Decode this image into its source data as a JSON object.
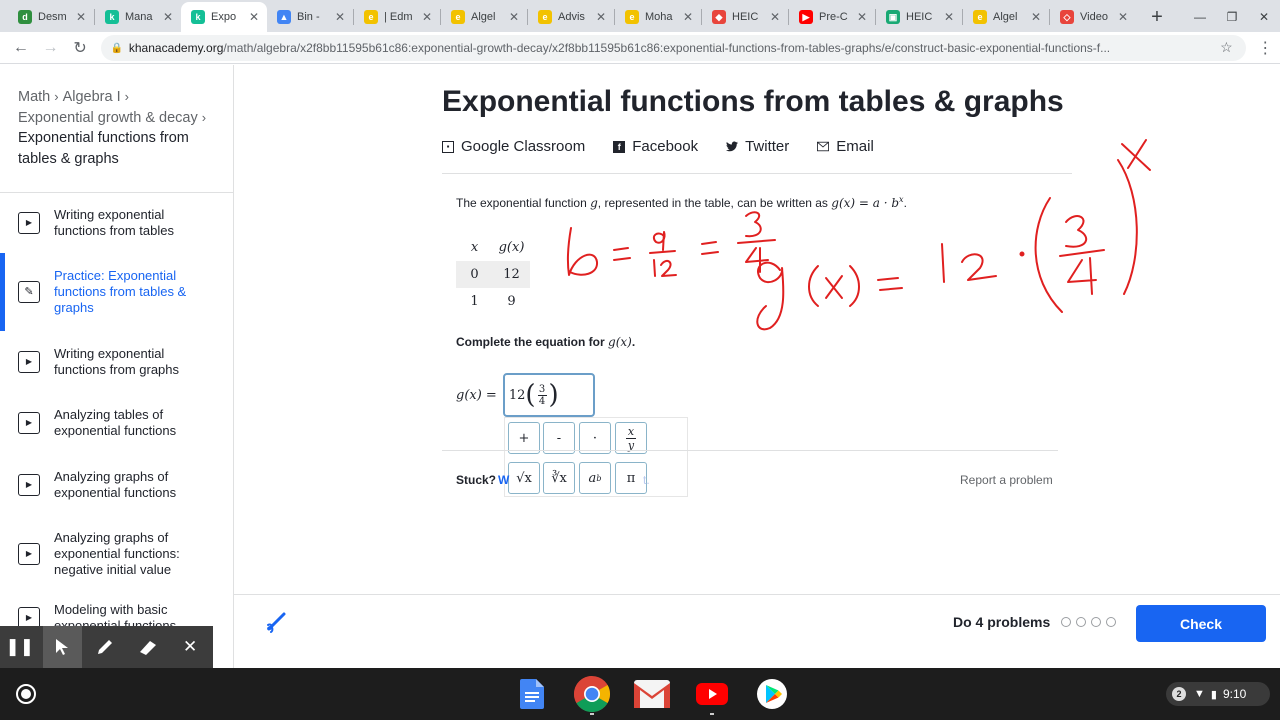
{
  "browser": {
    "tabs": [
      {
        "label": "Desm",
        "color": "#2f8f3f",
        "glyph": "d"
      },
      {
        "label": "Mana",
        "color": "#14bf96",
        "glyph": "k"
      },
      {
        "label": "Expo",
        "color": "#14bf96",
        "glyph": "k",
        "active": true
      },
      {
        "label": "Bin - ",
        "color": "#4285f4",
        "glyph": "▲"
      },
      {
        "label": "| Edm",
        "color": "#f2c200",
        "glyph": "e"
      },
      {
        "label": "Algel",
        "color": "#f2c200",
        "glyph": "e"
      },
      {
        "label": "Advis",
        "color": "#f2c200",
        "glyph": "e"
      },
      {
        "label": "Moha",
        "color": "#f2c200",
        "glyph": "e"
      },
      {
        "label": "HEIC",
        "color": "#e8453c",
        "glyph": "◆"
      },
      {
        "label": "Pre-C",
        "color": "#ff0000",
        "glyph": "▶"
      },
      {
        "label": "HEIC",
        "color": "#19a974",
        "glyph": "▣"
      },
      {
        "label": "Algel",
        "color": "#f2c200",
        "glyph": "e"
      },
      {
        "label": "Video",
        "color": "#e8453c",
        "glyph": "◇"
      }
    ],
    "new_tab": "+",
    "url_domain": "khanacademy.org",
    "url_path": "/math/algebra/x2f8bb11595b61c86:exponential-growth-decay/x2f8bb11595b61c86:exponential-functions-from-tables-graphs/e/construct-basic-exponential-functions-f..."
  },
  "sidebar": {
    "breadcrumb": {
      "math": "Math",
      "algebra": "Algebra I",
      "unit": "Exponential growth & decay",
      "current_line1": "Exponential functions from",
      "current_line2": "tables & graphs",
      "sep": "›"
    },
    "items": [
      {
        "label": "Writing exponential functions from tables",
        "type": "video",
        "h": 60
      },
      {
        "label": "Practice: Exponential functions from tables & graphs",
        "type": "practice",
        "active": true,
        "h": 78
      },
      {
        "label": "Writing exponential functions from graphs",
        "type": "video",
        "h": 61
      },
      {
        "label": "Analyzing tables of exponential functions",
        "type": "video",
        "h": 62
      },
      {
        "label": "Analyzing graphs of exponential functions",
        "type": "video",
        "h": 61
      },
      {
        "label": "Analyzing graphs of exponential functions: negative initial value",
        "type": "video",
        "h": 78
      },
      {
        "label": "Modeling with basic exponential functions",
        "type": "video",
        "h": 50
      }
    ]
  },
  "main": {
    "title": "Exponential functions from tables & graphs",
    "share": {
      "classroom": "Google Classroom",
      "facebook": "Facebook",
      "twitter": "Twitter",
      "email": "Email"
    },
    "prompt_pre": "The exponential function ",
    "prompt_var": "g",
    "prompt_mid": ", represented in the table, can be written as ",
    "prompt_formula": "g(x) = a · b",
    "prompt_exp": "x",
    "prompt_end": ".",
    "table": {
      "headers": [
        "x",
        "g(x)"
      ],
      "rows": [
        [
          "0",
          "12"
        ],
        [
          "1",
          "9"
        ]
      ]
    },
    "complete_label": "Complete the equation for ",
    "complete_var": "g(x)",
    "complete_end": ".",
    "answer_lhs": "g(x) =",
    "answer_value": {
      "coef": "12",
      "num": "3",
      "den": "4"
    },
    "keypad": {
      "plus": "+",
      "minus": "-",
      "dot": "·",
      "frac_num": "x",
      "frac_den": "y",
      "sqrt": "√x",
      "cbrt": "∛x",
      "pow_base": "a",
      "pow_exp": "b",
      "pi": "π"
    },
    "stuck_label": "Stuck?",
    "stuck_link": "W",
    "stuck_link_tail": "t.",
    "report": "Report a problem"
  },
  "footer": {
    "do_problems": "Do 4 problems",
    "progress_total": 4,
    "progress_done": 0,
    "check_label": "Check"
  },
  "handwriting": {
    "line1": "b = 9/12 = 3/4",
    "line2": "g(x) = 12 · (3/4)^x",
    "color": "#e02020"
  },
  "shelf": {
    "apps": [
      "docs-icon",
      "chrome-icon",
      "gmail-icon",
      "youtube-icon",
      "play-store-icon"
    ],
    "notifications": "2",
    "time": "9:10"
  },
  "colors": {
    "accent": "#1865f2",
    "text": "#21242c",
    "ink": "#e02020"
  }
}
